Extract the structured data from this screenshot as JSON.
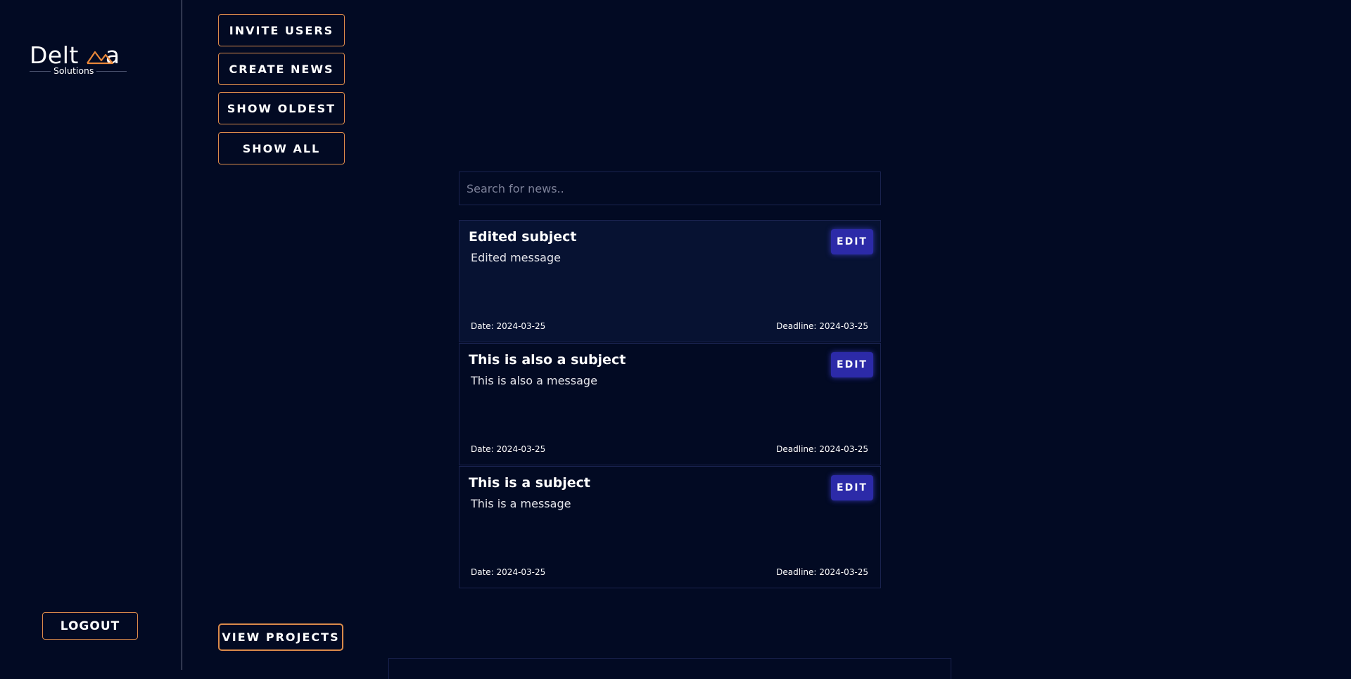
{
  "brand": {
    "name_left": "Delt",
    "name_right": "a",
    "subtitle": "Solutions",
    "accent": "#e8873a"
  },
  "sidebar": {
    "logout_label": "LOGOUT"
  },
  "actions": {
    "invite_users": "INVITE USERS",
    "create_news": "CREATE NEWS",
    "show_oldest": "SHOW OLDEST",
    "show_all": "SHOW ALL",
    "view_projects": "VIEW PROJECTS"
  },
  "search": {
    "placeholder": "Search for news.."
  },
  "news": [
    {
      "subject": "Edited subject",
      "message": "Edited message",
      "date": "Date: 2024-03-25",
      "deadline": "Deadline: 2024-03-25",
      "edit_label": "EDIT"
    },
    {
      "subject": "This is also a subject",
      "message": "This is also a message",
      "date": "Date: 2024-03-25",
      "deadline": "Deadline: 2024-03-25",
      "edit_label": "EDIT"
    },
    {
      "subject": "This is a subject",
      "message": "This is a message",
      "date": "Date: 2024-03-25",
      "deadline": "Deadline: 2024-03-25",
      "edit_label": "EDIT"
    }
  ],
  "colors": {
    "background": "#020a23",
    "button_border": "#d98a4a",
    "edit_button": "#2c2aa8",
    "card_border": "#1a2350"
  }
}
